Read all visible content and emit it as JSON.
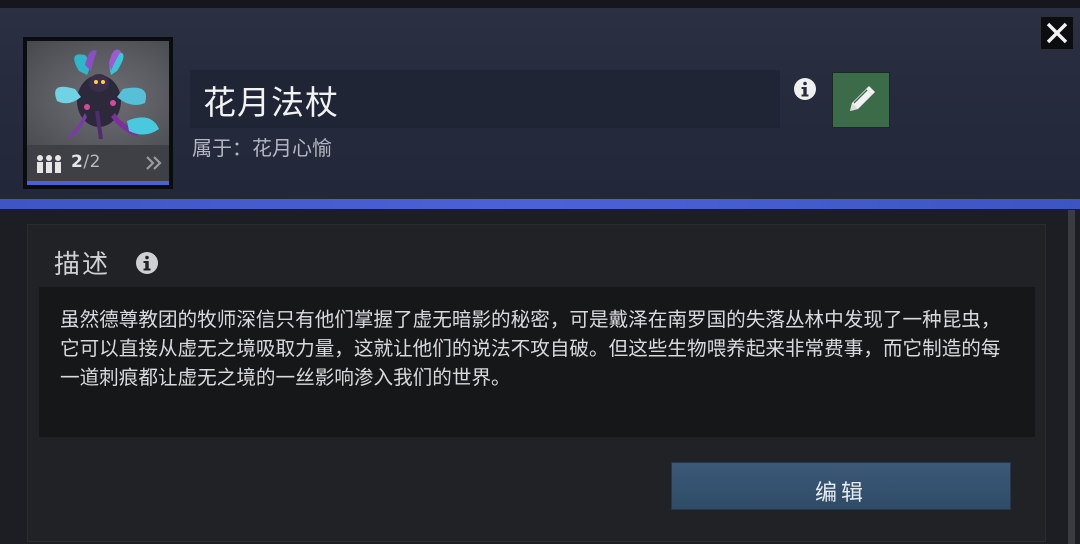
{
  "item": {
    "name": "花月法杖",
    "owner_prefix": "属于：",
    "owner_name": "花月心愉",
    "count_current": "2",
    "count_separator": "/",
    "count_total": "2"
  },
  "description": {
    "heading": "描述",
    "text": "虽然德尊教团的牧师深信只有他们掌握了虚无暗影的秘密，可是戴泽在南罗国的失落丛林中发现了一种昆虫，它可以直接从虚无之境吸取力量，这就让他们的说法不攻自破。但这些生物喂养起来非常费事，而它制造的每一道刺痕都让虚无之境的一丝影响渗入我们的世界。"
  },
  "actions": {
    "edit_label": "编辑"
  },
  "icons": {
    "close": "close-icon",
    "info": "info-icon",
    "edit": "pencil-icon",
    "count": "people-icon",
    "expand": "double-chevron-right-icon"
  },
  "colors": {
    "accent_bar": "#4a62d6",
    "edit_icon_button": "#3c6b4a",
    "primary_button": "#35536f"
  }
}
